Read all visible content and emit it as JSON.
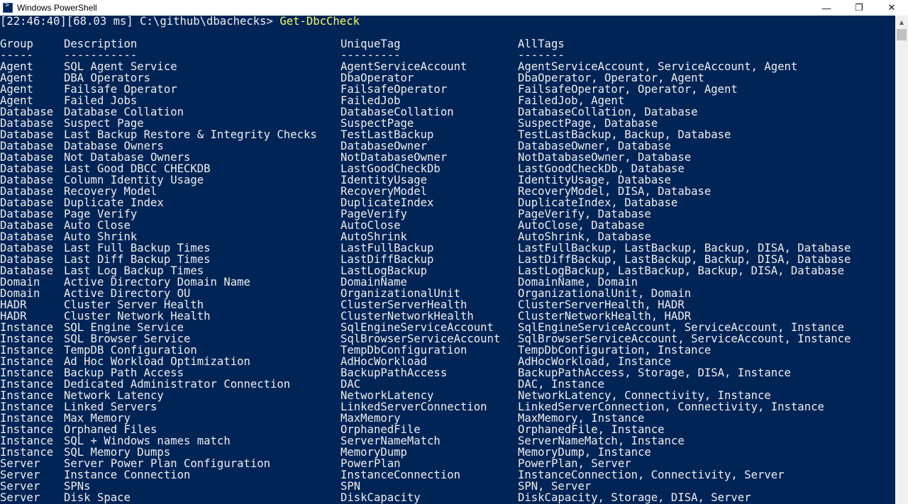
{
  "window": {
    "title": "Windows PowerShell",
    "minimize": "—",
    "maximize": "❐",
    "close": "✕"
  },
  "prompt": {
    "text": "[22:46:40][68.03 ms] C:\\github\\dbachecks> ",
    "command": "Get-DbcCheck"
  },
  "headers": [
    "Group",
    "Description",
    "UniqueTag",
    "AllTags"
  ],
  "separators": [
    "-----",
    "-----------",
    "---------",
    "-------"
  ],
  "rows": [
    [
      "Agent",
      "SQL Agent Service",
      "AgentServiceAccount",
      "AgentServiceAccount, ServiceAccount, Agent"
    ],
    [
      "Agent",
      "DBA Operators",
      "DbaOperator",
      "DbaOperator, Operator, Agent"
    ],
    [
      "Agent",
      "Failsafe Operator",
      "FailsafeOperator",
      "FailsafeOperator, Operator, Agent"
    ],
    [
      "Agent",
      "Failed Jobs",
      "FailedJob",
      "FailedJob, Agent"
    ],
    [
      "Database",
      "Database Collation",
      "DatabaseCollation",
      "DatabaseCollation, Database"
    ],
    [
      "Database",
      "Suspect Page",
      "SuspectPage",
      "SuspectPage, Database"
    ],
    [
      "Database",
      "Last Backup Restore & Integrity Checks",
      "TestLastBackup",
      "TestLastBackup, Backup, Database"
    ],
    [
      "Database",
      "Database Owners",
      "DatabaseOwner",
      "DatabaseOwner, Database"
    ],
    [
      "Database",
      "Not Database Owners",
      "NotDatabaseOwner",
      "NotDatabaseOwner, Database"
    ],
    [
      "Database",
      "Last Good DBCC CHECKDB",
      "LastGoodCheckDb",
      "LastGoodCheckDb, Database"
    ],
    [
      "Database",
      "Column Identity Usage",
      "IdentityUsage",
      "IdentityUsage, Database"
    ],
    [
      "Database",
      "Recovery Model",
      "RecoveryModel",
      "RecoveryModel, DISA, Database"
    ],
    [
      "Database",
      "Duplicate Index",
      "DuplicateIndex",
      "DuplicateIndex, Database"
    ],
    [
      "Database",
      "Page Verify",
      "PageVerify",
      "PageVerify, Database"
    ],
    [
      "Database",
      "Auto Close",
      "AutoClose",
      "AutoClose, Database"
    ],
    [
      "Database",
      "Auto Shrink",
      "AutoShrink",
      "AutoShrink, Database"
    ],
    [
      "Database",
      "Last Full Backup Times",
      "LastFullBackup",
      "LastFullBackup, LastBackup, Backup, DISA, Database"
    ],
    [
      "Database",
      "Last Diff Backup Times",
      "LastDiffBackup",
      "LastDiffBackup, LastBackup, Backup, DISA, Database"
    ],
    [
      "Database",
      "Last Log Backup Times",
      "LastLogBackup",
      "LastLogBackup, LastBackup, Backup, DISA, Database"
    ],
    [
      "Domain",
      "Active Directory Domain Name",
      "DomainName",
      "DomainName, Domain"
    ],
    [
      "Domain",
      "Active Directory OU",
      "OrganizationalUnit",
      "OrganizationalUnit, Domain"
    ],
    [
      "HADR",
      "Cluster Server Health",
      "ClusterServerHealth",
      "ClusterServerHealth, HADR"
    ],
    [
      "HADR",
      "Cluster Network Health",
      "ClusterNetworkHealth",
      "ClusterNetworkHealth, HADR"
    ],
    [
      "Instance",
      "SQL Engine Service",
      "SqlEngineServiceAccount",
      "SqlEngineServiceAccount, ServiceAccount, Instance"
    ],
    [
      "Instance",
      "SQL Browser Service",
      "SqlBrowserServiceAccount",
      "SqlBrowserServiceAccount, ServiceAccount, Instance"
    ],
    [
      "Instance",
      "TempDB Configuration",
      "TempDbConfiguration",
      "TempDbConfiguration, Instance"
    ],
    [
      "Instance",
      "Ad Hoc Workload Optimization",
      "AdHocWorkload",
      "AdHocWorkload, Instance"
    ],
    [
      "Instance",
      "Backup Path Access",
      "BackupPathAccess",
      "BackupPathAccess, Storage, DISA, Instance"
    ],
    [
      "Instance",
      "Dedicated Administrator Connection",
      "DAC",
      "DAC, Instance"
    ],
    [
      "Instance",
      "Network Latency",
      "NetworkLatency",
      "NetworkLatency, Connectivity, Instance"
    ],
    [
      "Instance",
      "Linked Servers",
      "LinkedServerConnection",
      "LinkedServerConnection, Connectivity, Instance"
    ],
    [
      "Instance",
      "Max Memory",
      "MaxMemory",
      "MaxMemory, Instance"
    ],
    [
      "Instance",
      "Orphaned Files",
      "OrphanedFile",
      "OrphanedFile, Instance"
    ],
    [
      "Instance",
      "SQL + Windows names match",
      "ServerNameMatch",
      "ServerNameMatch, Instance"
    ],
    [
      "Instance",
      "SQL Memory Dumps",
      "MemoryDump",
      "MemoryDump, Instance"
    ],
    [
      "Server",
      "Server Power Plan Configuration",
      "PowerPlan",
      "PowerPlan, Server"
    ],
    [
      "Server",
      "Instance Connection",
      "InstanceConnection",
      "InstanceConnection, Connectivity, Server"
    ],
    [
      "Server",
      "SPNs",
      "SPN",
      "SPN, Server"
    ],
    [
      "Server",
      "Disk Space",
      "DiskCapacity",
      "DiskCapacity, Storage, DISA, Server"
    ]
  ],
  "colors": {
    "background": "#012456",
    "text": "#eeedf0",
    "command": "#f7f76b"
  }
}
